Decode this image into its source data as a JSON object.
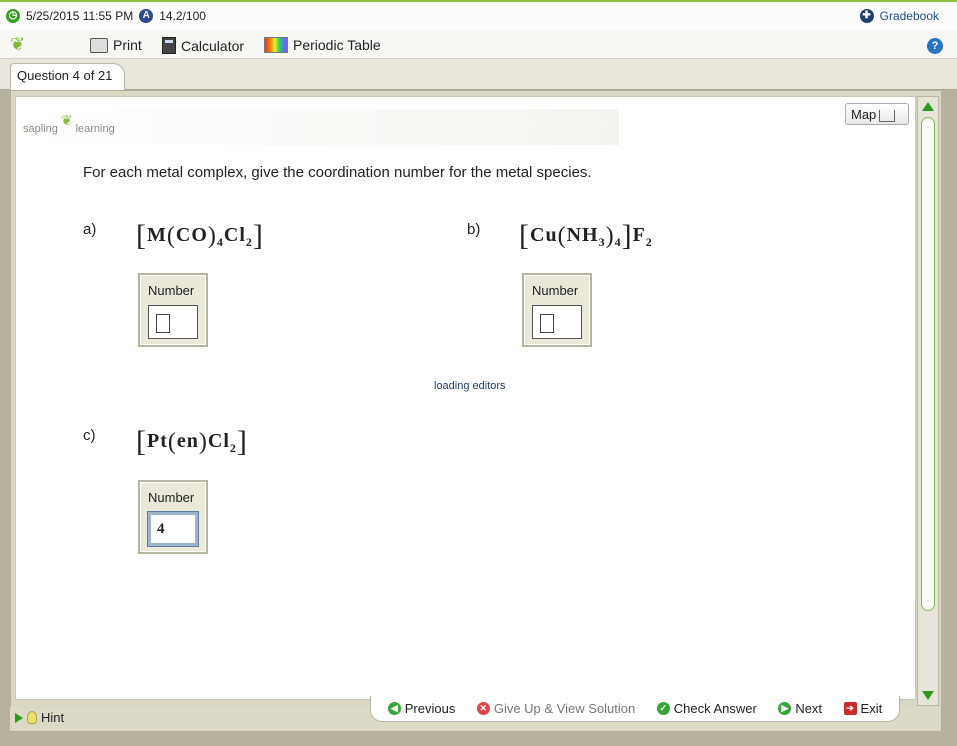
{
  "topbar": {
    "datetime": "5/25/2015 11:55 PM",
    "score": "14.2/100",
    "gradebook_label": "Gradebook"
  },
  "toolbar": {
    "print_label": "Print",
    "calculator_label": "Calculator",
    "periodic_table_label": "Periodic Table"
  },
  "tab": {
    "label": "Question 4 of 21"
  },
  "content": {
    "brand_left": "sapling",
    "brand_right": "learning",
    "map_label": "Map",
    "prompt": "For each metal complex, give the coordination number for the metal species.",
    "loading_text": "loading editors",
    "parts": [
      {
        "label": "a)",
        "formula_metal": "M",
        "formula_ligand": "CO",
        "formula_ligand_sub": "4",
        "formula_tail": "Cl",
        "formula_tail_sub": "2",
        "input_label": "Number",
        "input_value": ""
      },
      {
        "label": "b)",
        "formula_metal": "Cu",
        "formula_ligand": "NH",
        "formula_ligand_inner_sub": "3",
        "formula_ligand_sub": "4",
        "formula_counterion": "F",
        "formula_counterion_sub": "2",
        "input_label": "Number",
        "input_value": ""
      },
      {
        "label": "c)",
        "formula_metal": "Pt",
        "formula_ligand": "en",
        "formula_tail": "Cl",
        "formula_tail_sub": "2",
        "input_label": "Number",
        "input_value": "4"
      }
    ]
  },
  "bottom": {
    "hint_label": "Hint",
    "previous_label": "Previous",
    "giveup_label": "Give Up & View Solution",
    "check_label": "Check Answer",
    "next_label": "Next",
    "exit_label": "Exit"
  },
  "colors": {
    "accent_green": "#86b83b",
    "link_blue": "#1f4f8a"
  }
}
